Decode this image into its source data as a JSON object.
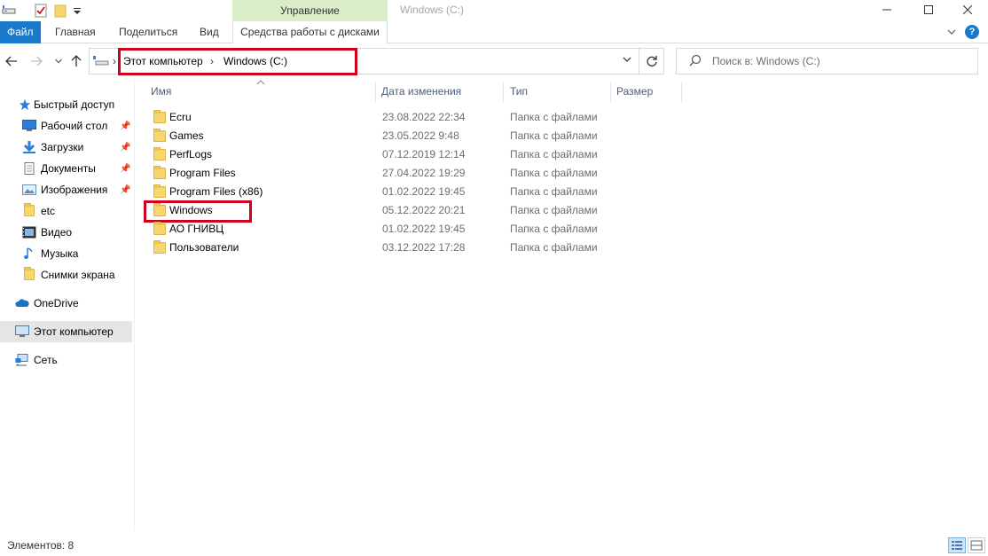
{
  "window": {
    "title": "Windows (C:)",
    "manage_tab": "Управление"
  },
  "ribbon": {
    "tabs": [
      "Файл",
      "Главная",
      "Поделиться",
      "Вид",
      "Средства работы с дисками"
    ],
    "help": "?"
  },
  "nav": {
    "breadcrumbs": [
      "Этот компьютер",
      "Windows (C:)"
    ],
    "separator": "›",
    "search_placeholder": "Поиск в: Windows (C:)"
  },
  "sidebar": {
    "items": [
      {
        "label": "Быстрый доступ",
        "icon": "star-icon"
      },
      {
        "label": "Рабочий стол",
        "icon": "desktop-icon",
        "pinned": true
      },
      {
        "label": "Загрузки",
        "icon": "download-icon",
        "pinned": true
      },
      {
        "label": "Документы",
        "icon": "documents-icon",
        "pinned": true
      },
      {
        "label": "Изображения",
        "icon": "pictures-icon",
        "pinned": true
      },
      {
        "label": "etc",
        "icon": "folder-icon"
      },
      {
        "label": "Видео",
        "icon": "video-icon"
      },
      {
        "label": "Музыка",
        "icon": "music-icon"
      },
      {
        "label": "Снимки экрана",
        "icon": "folder-icon"
      },
      {
        "label": "OneDrive",
        "icon": "cloud-icon"
      },
      {
        "label": "Этот компьютер",
        "icon": "computer-icon",
        "selected": true
      },
      {
        "label": "Сеть",
        "icon": "network-icon"
      }
    ]
  },
  "columns": {
    "name": "Имя",
    "date": "Дата изменения",
    "type": "Тип",
    "size": "Размер"
  },
  "files": [
    {
      "name": "Ecru",
      "date": "23.08.2022 22:34",
      "type": "Папка с файлами"
    },
    {
      "name": "Games",
      "date": "23.05.2022 9:48",
      "type": "Папка с файлами"
    },
    {
      "name": "PerfLogs",
      "date": "07.12.2019 12:14",
      "type": "Папка с файлами"
    },
    {
      "name": "Program Files",
      "date": "27.04.2022 19:29",
      "type": "Папка с файлами"
    },
    {
      "name": "Program Files (x86)",
      "date": "01.02.2022 19:45",
      "type": "Папка с файлами"
    },
    {
      "name": "Windows",
      "date": "05.12.2022 20:21",
      "type": "Папка с файлами"
    },
    {
      "name": "АО ГНИВЦ",
      "date": "01.02.2022 19:45",
      "type": "Папка с файлами"
    },
    {
      "name": "Пользователи",
      "date": "03.12.2022 17:28",
      "type": "Папка с файлами"
    }
  ],
  "status": {
    "items_count": "Элементов: 8"
  },
  "colors": {
    "accent": "#1979ca",
    "manage_tab_bg": "#d8edc8",
    "highlight_box": "#d0021b",
    "folder": "#f7d66e"
  }
}
